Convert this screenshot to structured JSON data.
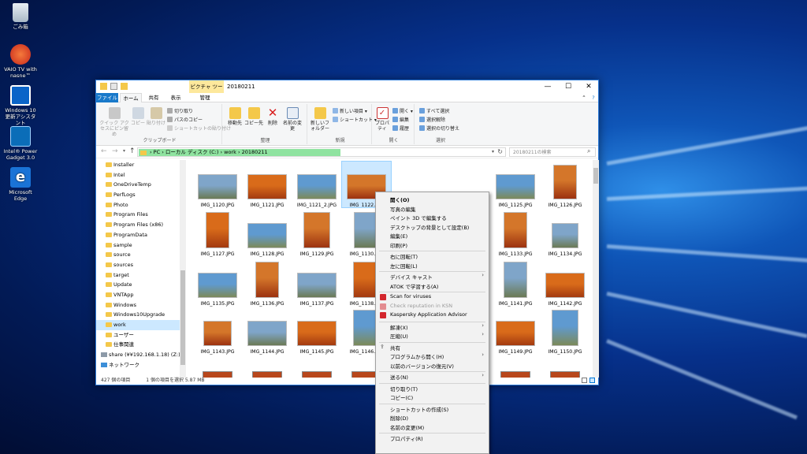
{
  "desktop": {
    "icons": [
      {
        "label": "ごみ箱",
        "icon": "recycle-bin-icon"
      },
      {
        "label": "VAIO TV with nasne™",
        "icon": "vaio-tv-icon"
      },
      {
        "label": "Windows 10 更新アシスタント",
        "icon": "windows-update-icon"
      },
      {
        "label": "Intel® Power Gadget 3.0",
        "icon": "intel-power-gadget-icon"
      },
      {
        "label": "Microsoft Edge",
        "icon": "edge-icon"
      }
    ]
  },
  "window": {
    "title": "20180211",
    "contextual_tab": "ピクチャ ツール",
    "tabs": [
      "ファイル",
      "ホーム",
      "共有",
      "表示",
      "管理"
    ],
    "controls": {
      "minimize": "—",
      "maximize": "☐",
      "close": "✕"
    }
  },
  "ribbon": {
    "clipboard": {
      "pin": "クイック アクセスにピン留め",
      "copy": "コピー",
      "paste": "貼り付け",
      "cut": "切り取り",
      "copy_path": "パスのコピー",
      "paste_shortcut": "ショートカットの貼り付け",
      "label": "クリップボード"
    },
    "organize": {
      "move_to": "移動先",
      "copy_to": "コピー先",
      "delete": "削除",
      "rename": "名前の変更",
      "label": "整理"
    },
    "new": {
      "new_folder": "新しいフォルダー",
      "new_item": "新しい項目 ▾",
      "shortcut": "ショートカット ▾",
      "label": "新規"
    },
    "open": {
      "properties": "プロパティ",
      "open": "開く ▾",
      "edit": "編集",
      "history": "履歴",
      "label": "開く"
    },
    "select": {
      "select_all": "すべて選択",
      "select_none": "選択解除",
      "invert": "選択の切り替え",
      "label": "選択"
    }
  },
  "address": {
    "path": [
      "PC",
      "ローカル ディスク (C:)",
      "work",
      "20180211"
    ],
    "search_placeholder": "20180211の検索"
  },
  "nav_pane": {
    "items": [
      "Installer",
      "Intel",
      "OneDriveTemp",
      "PerfLogs",
      "Photo",
      "Program Files",
      "Program Files (x86)",
      "ProgramData",
      "sample",
      "source",
      "sources",
      "target",
      "Update",
      "VNTApp",
      "Windows",
      "Windows10Upgrade",
      "work",
      "ユーザー",
      "仕事関連",
      "share (¥¥192.168.1.18) (Z:)",
      "ネットワーク"
    ],
    "selected": "work"
  },
  "files": {
    "row1": [
      "IMG_1120.JPG",
      "IMG_1121.JPG",
      "IMG_1121_2.JPG",
      "IMG_1122.JPG",
      "",
      "",
      "IMG_1125.JPG",
      "IMG_1126.JPG"
    ],
    "row2": [
      "IMG_1127.JPG",
      "IMG_1128.JPG",
      "IMG_1129.JPG",
      "IMG_1130.JPG",
      "",
      "",
      "IMG_1133.JPG",
      "IMG_1134.JPG"
    ],
    "row3": [
      "IMG_1135.JPG",
      "IMG_1136.JPG",
      "IMG_1137.JPG",
      "IMG_1138.JPG",
      "",
      "",
      "IMG_1141.JPG",
      "IMG_1142.JPG"
    ],
    "row4": [
      "IMG_1143.JPG",
      "IMG_1144.JPG",
      "IMG_1145.JPG",
      "IMG_1146.JPG",
      "",
      "",
      "IMG_1149.JPG",
      "IMG_1150.JPG"
    ],
    "selected": "IMG_1122.JPG"
  },
  "status": {
    "count": "427 個の項目",
    "selection": "1 個の項目を選択  5.87 MB"
  },
  "context_menu": {
    "items": [
      {
        "label": "開く(O)",
        "bold": true
      },
      {
        "label": "写真の編集"
      },
      {
        "label": "ペイント 3D で編集する"
      },
      {
        "label": "デスクトップの背景として設定(B)"
      },
      {
        "label": "編集(E)"
      },
      {
        "label": "印刷(P)"
      },
      {
        "sep": true
      },
      {
        "label": "右に回転(T)"
      },
      {
        "label": "左に回転(L)"
      },
      {
        "sep": true
      },
      {
        "label": "デバイス キャスト",
        "sub": true
      },
      {
        "label": "ATOK で学習する(A)"
      },
      {
        "sep": true
      },
      {
        "label": "Scan for viruses",
        "k": true
      },
      {
        "label": "Check reputation in KSN",
        "k": true,
        "dis": true
      },
      {
        "label": "Kaspersky Application Advisor",
        "k": true
      },
      {
        "sep": true
      },
      {
        "label": "解凍(X)",
        "sub": true
      },
      {
        "label": "圧縮(U)",
        "sub": true
      },
      {
        "sep": true
      },
      {
        "label": "共有"
      },
      {
        "label": "プログラムから開く(H)",
        "sub": true
      },
      {
        "label": "以前のバージョンの復元(V)"
      },
      {
        "sep": true
      },
      {
        "label": "送る(N)",
        "sub": true
      },
      {
        "sep": true
      },
      {
        "label": "切り取り(T)"
      },
      {
        "label": "コピー(C)"
      },
      {
        "sep": true
      },
      {
        "label": "ショートカットの作成(S)"
      },
      {
        "label": "削除(D)"
      },
      {
        "label": "名前の変更(M)"
      },
      {
        "sep": true
      },
      {
        "label": "プロパティ(R)"
      }
    ]
  },
  "colors": {
    "accent": "#0078d7",
    "selection": "#cce8ff",
    "crumb_highlight": "#8fe3a0",
    "picture_tools": "#fde89c"
  }
}
